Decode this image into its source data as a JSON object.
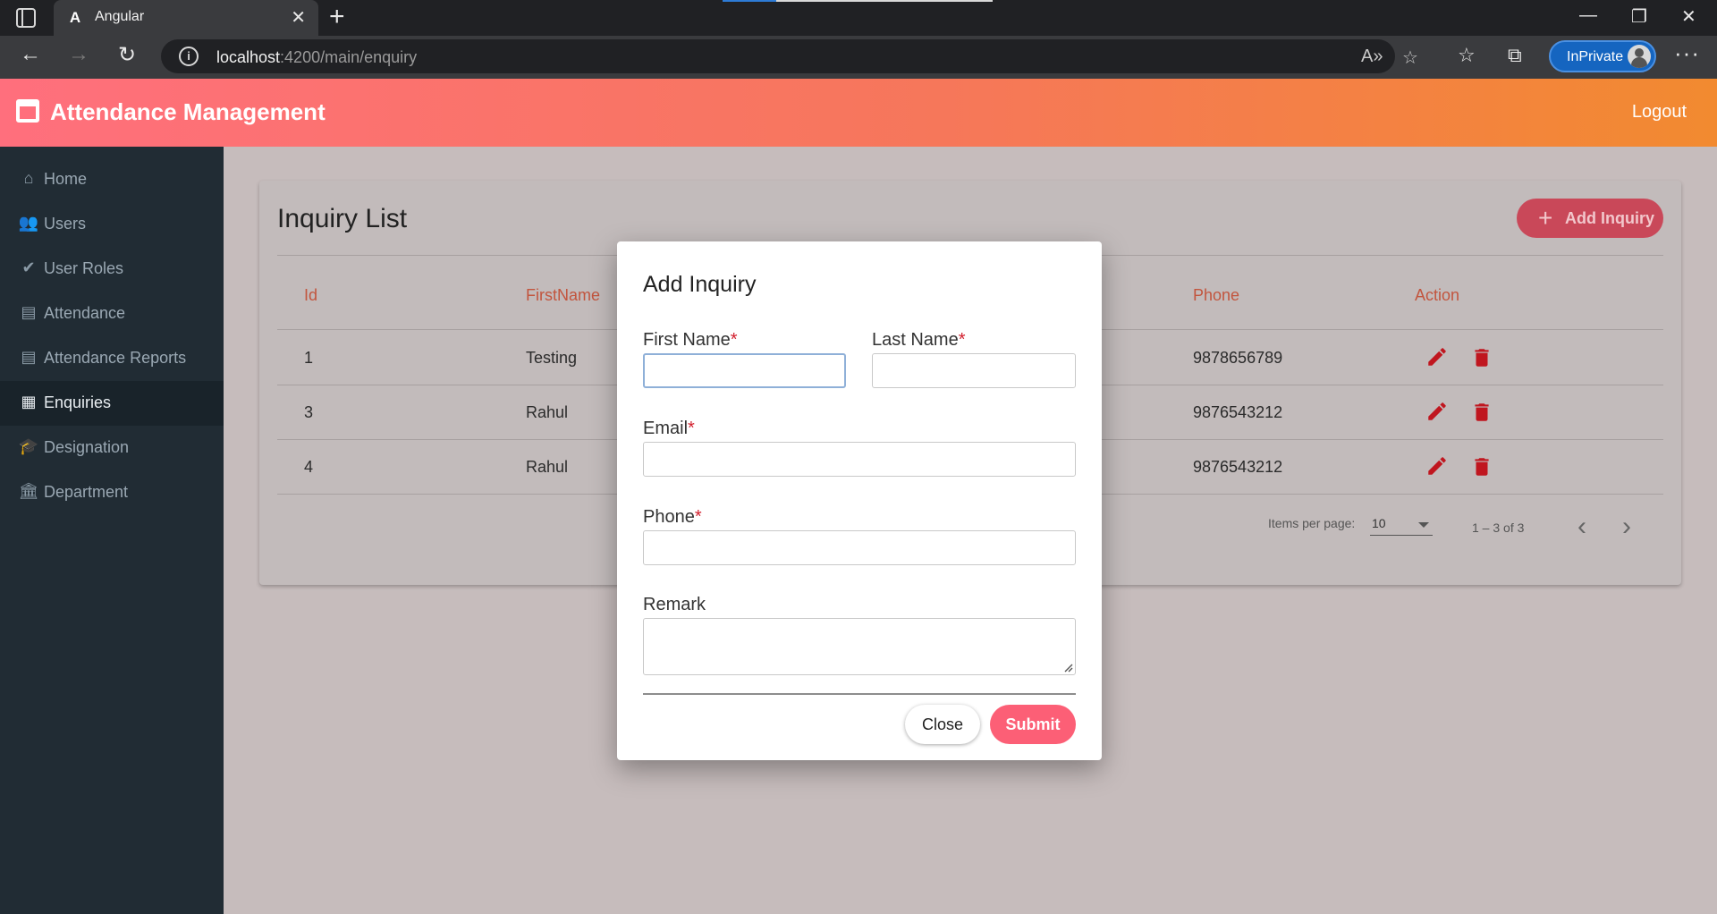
{
  "browser": {
    "tab_title": "Angular",
    "tab_logo": "A",
    "url_host": "localhost",
    "url_path": ":4200/main/enquiry",
    "inprivate_label": "InPrivate"
  },
  "app": {
    "title": "Attendance Management",
    "logout_label": "Logout"
  },
  "sidebar": {
    "items": [
      {
        "label": "Home",
        "icon": "home-icon"
      },
      {
        "label": "Users",
        "icon": "users-icon"
      },
      {
        "label": "User Roles",
        "icon": "user-check-icon"
      },
      {
        "label": "Attendance",
        "icon": "list-icon"
      },
      {
        "label": "Attendance Reports",
        "icon": "list-icon"
      },
      {
        "label": "Enquiries",
        "icon": "table-list-icon"
      },
      {
        "label": "Designation",
        "icon": "graduation-cap-icon"
      },
      {
        "label": "Department",
        "icon": "building-columns-icon"
      }
    ],
    "active": "Enquiries"
  },
  "inquiry_list": {
    "title": "Inquiry List",
    "add_button_label": "Add Inquiry",
    "columns": [
      "Id",
      "FirstName",
      "Phone",
      "Action"
    ],
    "rows": [
      {
        "id": "1",
        "first_name": "Testing",
        "phone": "9878656789"
      },
      {
        "id": "3",
        "first_name": "Rahul",
        "phone": "9876543212"
      },
      {
        "id": "4",
        "first_name": "Rahul",
        "phone": "9876543212"
      }
    ],
    "paginator": {
      "items_per_page_label": "Items per page:",
      "page_size": "10",
      "range_label": "1 – 3 of 3"
    }
  },
  "modal": {
    "title": "Add Inquiry",
    "fields": {
      "first_name": {
        "label": "First Name",
        "value": ""
      },
      "last_name": {
        "label": "Last Name",
        "value": ""
      },
      "email": {
        "label": "Email",
        "value": ""
      },
      "phone": {
        "label": "Phone",
        "value": ""
      },
      "remark": {
        "label": "Remark",
        "value": ""
      }
    },
    "required_marker": "*",
    "close_label": "Close",
    "submit_label": "Submit"
  },
  "colors": {
    "accent_gradient_start": "#ff6f7d",
    "accent_gradient_end": "#f28a30",
    "submit_button": "#fc5f76",
    "table_header_text": "#c2553e",
    "action_icon": "#c0161f"
  }
}
